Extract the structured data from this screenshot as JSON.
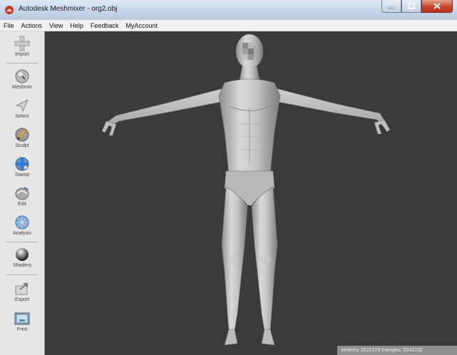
{
  "window": {
    "title": "Autodesk Meshmixer - org2.obj",
    "minimize_icon": "minimize-icon",
    "maximize_icon": "maximize-icon",
    "close_icon": "close-icon"
  },
  "menubar": {
    "items": [
      "File",
      "Actions",
      "View",
      "Help",
      "Feedback",
      "MyAccount"
    ]
  },
  "sidebar": {
    "tools": [
      {
        "label": "Import",
        "icon": "import-plus-icon"
      },
      {
        "label": "Meshmix",
        "icon": "meshmix-icon"
      },
      {
        "label": "Select",
        "icon": "select-arrow-icon"
      },
      {
        "label": "Sculpt",
        "icon": "sculpt-brush-icon"
      },
      {
        "label": "Stamp",
        "icon": "stamp-icon"
      },
      {
        "label": "Edit",
        "icon": "edit-icon"
      },
      {
        "label": "Analysis",
        "icon": "analysis-icon"
      },
      {
        "label": "Shaders",
        "icon": "shaders-sphere-icon"
      },
      {
        "label": "Export",
        "icon": "export-icon"
      },
      {
        "label": "Print",
        "icon": "print-icon"
      }
    ]
  },
  "viewport": {
    "model": "human-body-mesh",
    "background": "#3b3b3b"
  },
  "status": {
    "text": "vertices: 2621078 triangles: 5242152"
  },
  "colors": {
    "titlebar": "#c7d6e8",
    "sidebar": "#e6e6e6",
    "mesh": "#c4c4c4",
    "status_bar": "#8e8e8e"
  }
}
